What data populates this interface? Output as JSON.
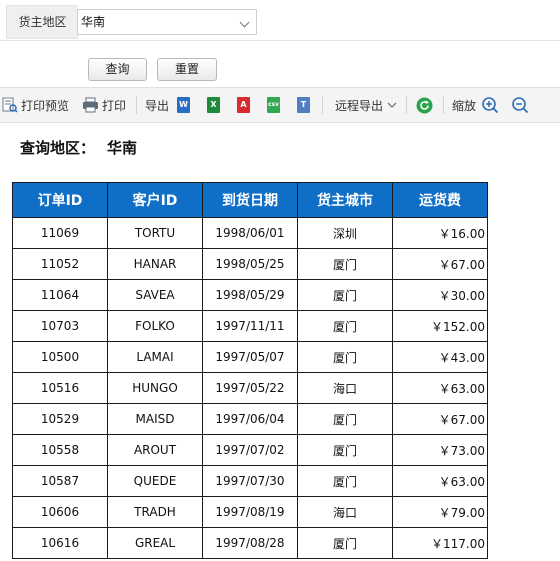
{
  "filter": {
    "label": "货主地区",
    "value": "华南"
  },
  "buttons": {
    "query": "查询",
    "reset": "重置"
  },
  "toolbar": {
    "print_preview": "打印预览",
    "print": "打印",
    "export": "导出",
    "remote_export": "远程导出",
    "zoom": "缩放",
    "file_icons": [
      {
        "name": "word-icon",
        "letter": "W",
        "color": "#2b6cc4"
      },
      {
        "name": "excel-icon",
        "letter": "X",
        "color": "#1f8a3b"
      },
      {
        "name": "pdf-icon",
        "letter": "⅄",
        "color": "#d92b2b"
      },
      {
        "name": "csv-icon",
        "letter": "csv",
        "color": "#32a852"
      },
      {
        "name": "text-icon",
        "letter": "T",
        "color": "#4d7fc2"
      }
    ]
  },
  "title": {
    "label": "查询地区：",
    "value": "华南"
  },
  "table": {
    "headers": [
      "订单ID",
      "客户ID",
      "到货日期",
      "货主城市",
      "运货费"
    ],
    "rows": [
      [
        "11069",
        "TORTU",
        "1998/06/01",
        "深圳",
        "￥16.00"
      ],
      [
        "11052",
        "HANAR",
        "1998/05/25",
        "厦门",
        "￥67.00"
      ],
      [
        "11064",
        "SAVEA",
        "1998/05/29",
        "厦门",
        "￥30.00"
      ],
      [
        "10703",
        "FOLKO",
        "1997/11/11",
        "厦门",
        "￥152.00"
      ],
      [
        "10500",
        "LAMAI",
        "1997/05/07",
        "厦门",
        "￥43.00"
      ],
      [
        "10516",
        "HUNGO",
        "1997/05/22",
        "海口",
        "￥63.00"
      ],
      [
        "10529",
        "MAISD",
        "1997/06/04",
        "厦门",
        "￥67.00"
      ],
      [
        "10558",
        "AROUT",
        "1997/07/02",
        "厦门",
        "￥73.00"
      ],
      [
        "10587",
        "QUEDE",
        "1997/07/30",
        "厦门",
        "￥63.00"
      ],
      [
        "10606",
        "TRADH",
        "1997/08/19",
        "海口",
        "￥79.00"
      ],
      [
        "10616",
        "GREAL",
        "1997/08/28",
        "厦门",
        "￥117.00"
      ]
    ]
  }
}
